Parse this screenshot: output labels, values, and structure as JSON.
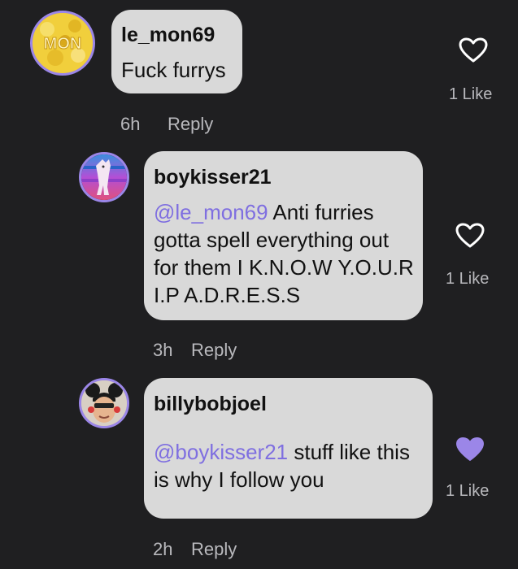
{
  "comments": [
    {
      "username": "le_mon69",
      "text": "Fuck furrys",
      "time": "6h",
      "reply_label": "Reply",
      "likes_label": "1 Like",
      "liked": false,
      "avatar_text": "MON"
    },
    {
      "username": "boykisser21",
      "mention": "@le_mon69",
      "text_line1": " Anti furries",
      "text_line2": "gotta spell everything out",
      "text_line3": "for them I K.N.O.W Y.O.U.R",
      "text_line4": "I.P A.D.R.E.S.S",
      "time": "3h",
      "reply_label": "Reply",
      "likes_label": "1 Like",
      "liked": false
    },
    {
      "username": "billybobjoel",
      "mention": "@boykisser21",
      "text_line1": " stuff like this",
      "text_line2": "is why I follow you",
      "time": "2h",
      "reply_label": "Reply",
      "likes_label": "1 Like",
      "liked": true
    }
  ],
  "colors": {
    "background": "#1f1f21",
    "bubble": "#d9d9d9",
    "mention": "#7f6fe0",
    "liked_heart": "#9b86e8",
    "avatar_border": "#9b86e8"
  },
  "icons": [
    "heart-outline-icon",
    "heart-filled-icon"
  ]
}
